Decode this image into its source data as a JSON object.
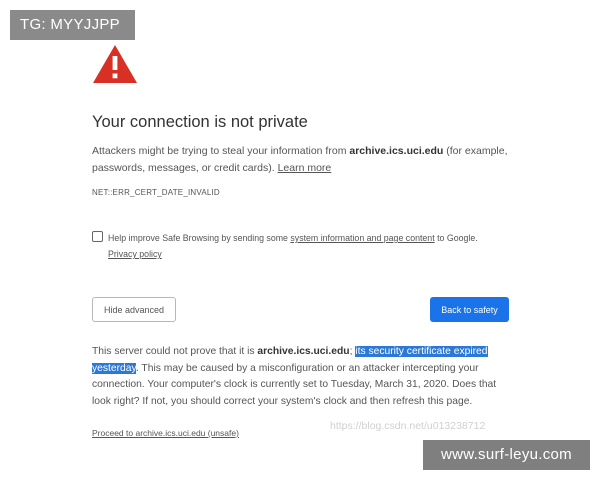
{
  "overlay": {
    "tg_label": "TG: MYYJJPP",
    "domain_label": "www.surf-leyu.com",
    "watermark_text": "https://blog.csdn.net/u013238712"
  },
  "warning": {
    "icon": "warning-triangle-icon",
    "title": "Your connection is not private",
    "intro_before": "Attackers might be trying to steal your information from ",
    "host": "archive.ics.uci.edu",
    "intro_after": " (for example, passwords, messages, or credit cards). ",
    "learn_more": "Learn more",
    "error_code": "NET::ERR_CERT_DATE_INVALID"
  },
  "safe_browsing": {
    "checked": false,
    "text_before": "Help improve Safe Browsing by sending some ",
    "link_text": "system information and page content",
    "text_after": " to Google.",
    "privacy_link": "Privacy policy"
  },
  "buttons": {
    "hide_advanced": "Hide advanced",
    "back_to_safety": "Back to safety"
  },
  "details": {
    "before": "This server could not prove that it is ",
    "host": "archive.ics.uci.edu",
    "sep": "; ",
    "highlighted": "its security certificate expired yesterday",
    "after": ". This may be caused by a misconfiguration or an attacker intercepting your connection. Your computer's clock is currently set to Tuesday, March 31, 2020. Does that look right? If not, you should correct your system's clock and then refresh this page.",
    "proceed_link": "Proceed to archive.ics.uci.edu (unsafe)"
  },
  "colors": {
    "accent_blue": "#1a73e8",
    "warning_red": "#d93025",
    "selection": "#2b78d6"
  }
}
